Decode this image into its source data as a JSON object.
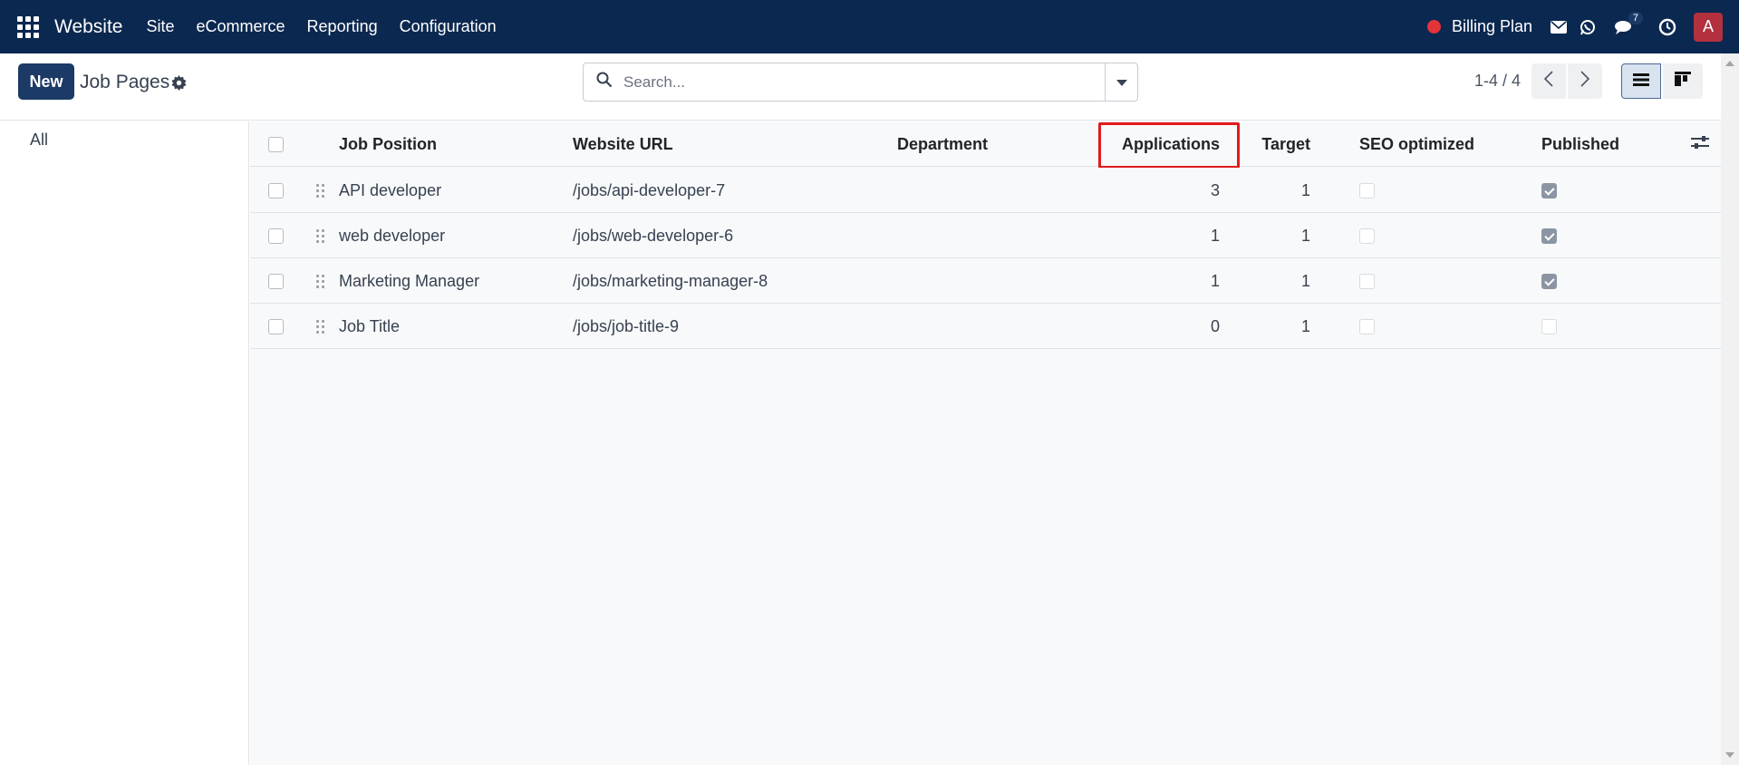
{
  "navbar": {
    "brand": "Website",
    "menu": [
      "Site",
      "eCommerce",
      "Reporting",
      "Configuration"
    ],
    "billing_label": "Billing Plan",
    "chat_badge": "7",
    "avatar_letter": "A"
  },
  "control_panel": {
    "new_label": "New",
    "title": "Job Pages",
    "search_placeholder": "Search...",
    "pager": "1-4 / 4"
  },
  "sidebar": {
    "items": [
      "All"
    ]
  },
  "table": {
    "headers": {
      "job_position": "Job Position",
      "website_url": "Website URL",
      "department": "Department",
      "applications": "Applications",
      "target": "Target",
      "seo_optimized": "SEO optimized",
      "published": "Published"
    },
    "rows": [
      {
        "job_position": "API developer",
        "website_url": "/jobs/api-developer-7",
        "department": "",
        "applications": "3",
        "target": "1",
        "seo_optimized": false,
        "published": true
      },
      {
        "job_position": "web developer",
        "website_url": "/jobs/web-developer-6",
        "department": "",
        "applications": "1",
        "target": "1",
        "seo_optimized": false,
        "published": true
      },
      {
        "job_position": "Marketing Manager",
        "website_url": "/jobs/marketing-manager-8",
        "department": "",
        "applications": "1",
        "target": "1",
        "seo_optimized": false,
        "published": true
      },
      {
        "job_position": "Job Title",
        "website_url": "/jobs/job-title-9",
        "department": "",
        "applications": "0",
        "target": "1",
        "seo_optimized": false,
        "published": false
      }
    ]
  },
  "colors": {
    "navbar": "#0b2850",
    "primary": "#1b3a66",
    "highlight": "#e11b1b",
    "avatar": "#b3303f",
    "status_dot": "#e3343a"
  },
  "icons": [
    "apps-icon",
    "envelope-icon",
    "whatsapp-icon",
    "chat-icon",
    "clock-icon",
    "gear-icon",
    "search-icon",
    "caret-down-icon",
    "chevron-left-icon",
    "chevron-right-icon",
    "list-view-icon",
    "kanban-view-icon",
    "optional-columns-icon",
    "drag-handle-icon"
  ]
}
